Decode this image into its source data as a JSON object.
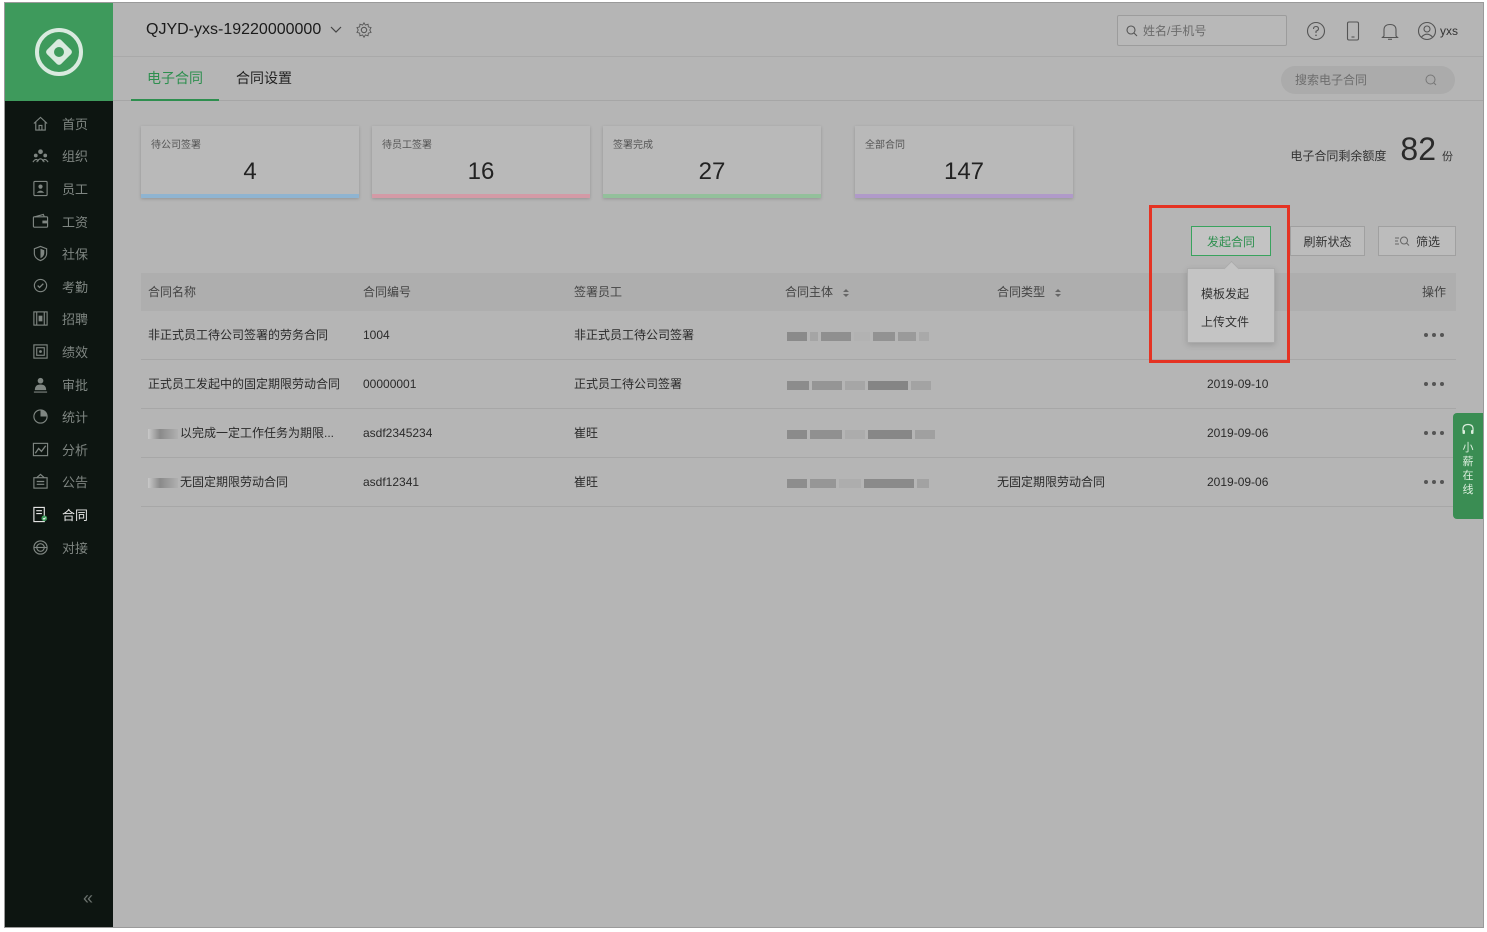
{
  "header": {
    "company": "QJYD-yxs-19220000000",
    "search_placeholder": "姓名/手机号",
    "user": "yxs"
  },
  "sidebar": {
    "items": [
      {
        "label": "首页",
        "icon": "home-icon"
      },
      {
        "label": "组织",
        "icon": "org-icon"
      },
      {
        "label": "员工",
        "icon": "employee-icon"
      },
      {
        "label": "工资",
        "icon": "wallet-icon"
      },
      {
        "label": "社保",
        "icon": "shield-icon"
      },
      {
        "label": "考勤",
        "icon": "location-icon"
      },
      {
        "label": "招聘",
        "icon": "recruit-icon"
      },
      {
        "label": "绩效",
        "icon": "performance-icon"
      },
      {
        "label": "审批",
        "icon": "approval-icon"
      },
      {
        "label": "统计",
        "icon": "pie-icon"
      },
      {
        "label": "分析",
        "icon": "analysis-icon"
      },
      {
        "label": "公告",
        "icon": "notice-icon"
      },
      {
        "label": "合同",
        "icon": "contract-icon",
        "active": true
      },
      {
        "label": "对接",
        "icon": "connect-icon"
      }
    ],
    "collapse": "«"
  },
  "tabs": [
    {
      "label": "电子合同",
      "active": true
    },
    {
      "label": "合同设置",
      "active": false
    }
  ],
  "contract_search_placeholder": "搜索电子合同",
  "stats": [
    {
      "label": "待公司签署",
      "value": "4",
      "color": "#8fb4d1"
    },
    {
      "label": "待员工签署",
      "value": "16",
      "color": "#d39aa6"
    },
    {
      "label": "签署完成",
      "value": "27",
      "color": "#93c09b"
    },
    {
      "label": "全部合同",
      "value": "147",
      "color": "#b09ac9"
    }
  ],
  "quota": {
    "label": "电子合同剩余额度",
    "value": "82",
    "unit": "份"
  },
  "actions": {
    "initiate": "发起合同",
    "refresh": "刷新状态",
    "filter": "筛选"
  },
  "dropdown": {
    "items": [
      "模板发起",
      "上传文件"
    ]
  },
  "table": {
    "columns": [
      "合同名称",
      "合同编号",
      "签署员工",
      "合同主体",
      "合同类型",
      "操作"
    ],
    "rows": [
      {
        "name": "非正式员工待公司签署的劳务合同",
        "masked_prefix": false,
        "number": "1004",
        "employee": "非正式员工待公司签署",
        "type": "",
        "date": ""
      },
      {
        "name": "正式员工发起中的固定期限劳动合同",
        "masked_prefix": false,
        "number": "00000001",
        "employee": "正式员工待公司签署",
        "type": "",
        "date": "2019-09-10"
      },
      {
        "name": "以完成一定工作任务为期限...",
        "masked_prefix": true,
        "number": "asdf2345234",
        "employee": "崔旺",
        "type": "",
        "date": "2019-09-06"
      },
      {
        "name": "无固定期限劳动合同",
        "masked_prefix": true,
        "number": "asdf12341",
        "employee": "崔旺",
        "type": "无固定期限劳动合同",
        "date": "2019-09-06"
      }
    ]
  },
  "chat_widget": {
    "label": [
      "小",
      "薪",
      "在",
      "线"
    ]
  },
  "colors": {
    "accent": "#2e8f4f",
    "highlight": "#e53323",
    "sidebar": "#0d1511"
  }
}
